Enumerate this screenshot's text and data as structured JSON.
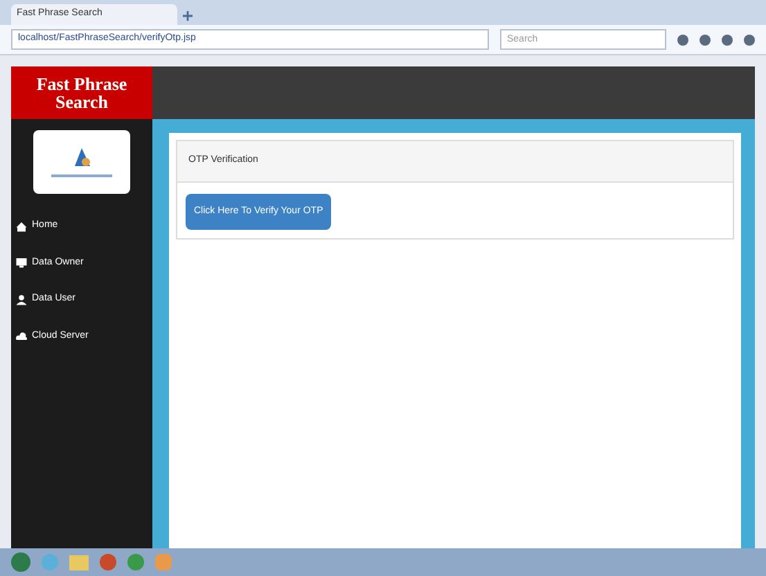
{
  "browser": {
    "tab_title": "Fast Phrase Search",
    "url": "localhost/FastPhraseSearch/verifyOtp.jsp",
    "search_placeholder": "Search"
  },
  "header": {
    "logo_text": "Fast Phrase Search"
  },
  "sidebar": {
    "items": [
      {
        "label": "Home",
        "selected": false
      },
      {
        "label": "Data Owner",
        "selected": false
      },
      {
        "label": "Data User",
        "selected": false
      },
      {
        "label": "Cloud Server",
        "selected": false
      }
    ]
  },
  "card": {
    "title": "OTP Verification",
    "button": "Click Here To Verify Your OTP"
  }
}
